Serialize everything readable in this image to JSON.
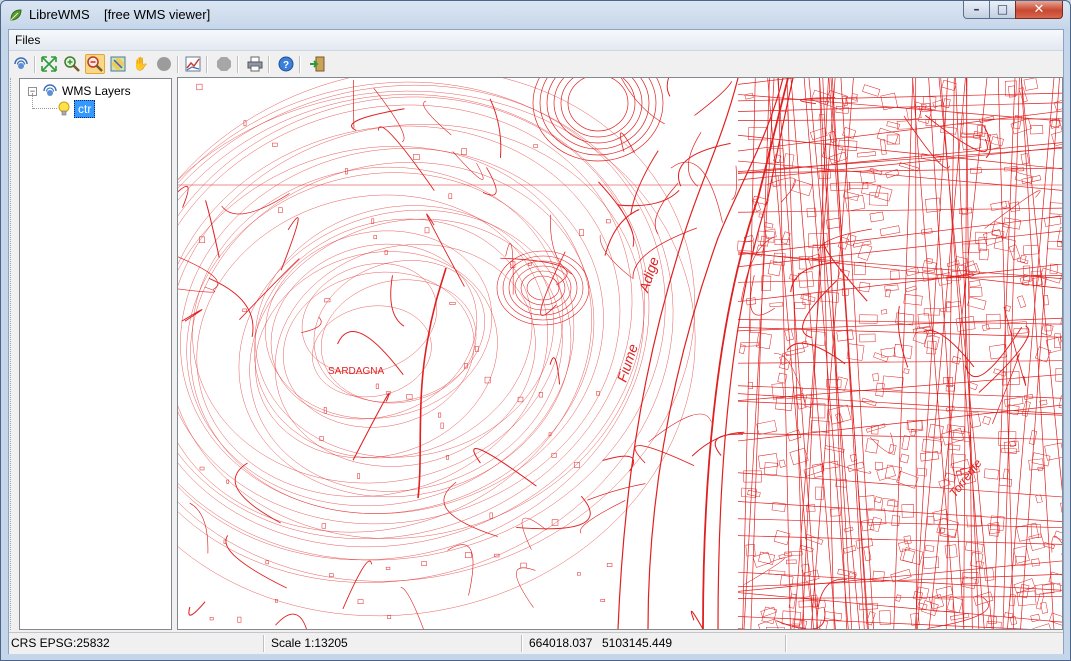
{
  "window": {
    "app_name": "LibreWMS",
    "subtitle": "[free WMS viewer]",
    "controls": {
      "minimize": "–",
      "maximize": "□",
      "close": "✕"
    }
  },
  "menu": {
    "files": "Files"
  },
  "toolbar": {
    "buttons": [
      {
        "name": "connect-wms-icon",
        "glyph": "📡"
      },
      {
        "name": "zoom-extent-icon",
        "glyph": "⤢"
      },
      {
        "name": "zoom-in-icon",
        "glyph": "🔍"
      },
      {
        "name": "zoom-out-icon",
        "glyph": "🔍"
      },
      {
        "name": "zoom-box-icon",
        "glyph": "▦"
      },
      {
        "name": "pan-hand-icon",
        "glyph": "✋"
      },
      {
        "name": "stop-icon",
        "glyph": "●"
      },
      {
        "name": "layer-chart-icon",
        "glyph": "📈"
      },
      {
        "name": "disabled-stop-icon",
        "glyph": "⬣"
      },
      {
        "name": "print-icon",
        "glyph": "🖨"
      },
      {
        "name": "help-icon",
        "glyph": "?"
      },
      {
        "name": "exit-icon",
        "glyph": "⇥"
      }
    ]
  },
  "layers": {
    "root_label": "WMS Layers",
    "expander": "−",
    "items": [
      {
        "label": "ctr"
      }
    ]
  },
  "map": {
    "labels": {
      "sardagna": "SARDAGNA",
      "fiume": "Fiume",
      "adige": "Adige",
      "torrente": "Torrente"
    },
    "line_color": "#e02020"
  },
  "status": {
    "crs": "CRS EPSG:25832",
    "scale": "Scale 1:13205",
    "x": "664018.037",
    "y": "5103145.449"
  }
}
